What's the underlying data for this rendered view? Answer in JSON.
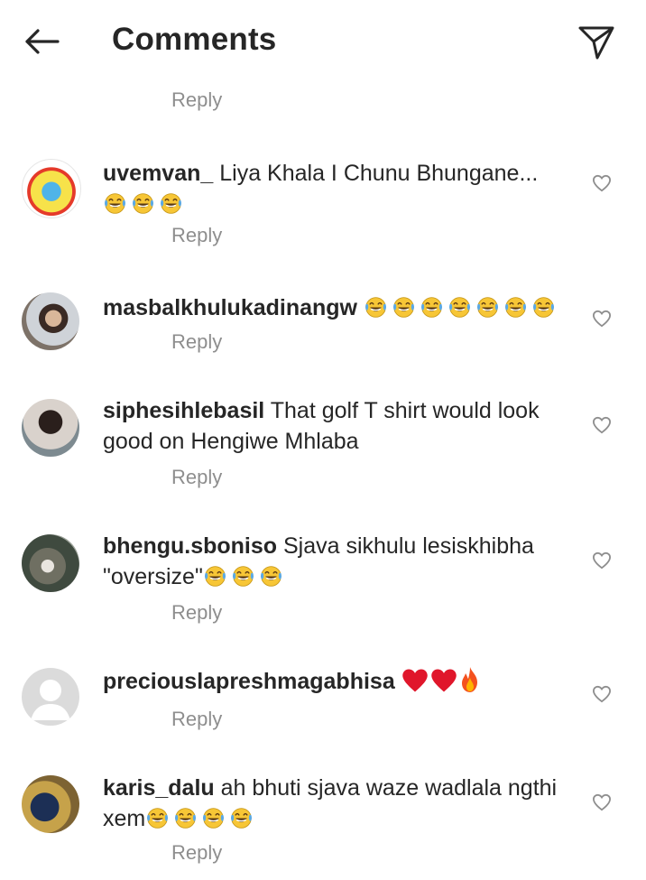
{
  "header": {
    "title": "Comments",
    "back_icon": "arrow-left-icon",
    "send_icon": "paper-plane-icon"
  },
  "top_reply_label": "Reply",
  "comments": [
    {
      "username": "uvemvan_",
      "text": " Liya Khala I Chunu Bhungane...",
      "emojis": 3,
      "reply_label": "Reply"
    },
    {
      "username": "masbalkhulukadinangw",
      "text": " ",
      "emojis": 7,
      "reply_label": "Reply"
    },
    {
      "username": "siphesihlebasil",
      "text": " That golf T shirt would look good on Hengiwe Mhlaba",
      "emojis": 0,
      "reply_label": "Reply"
    },
    {
      "username": "bhengu.sboniso",
      "text": " Sjava sikhulu lesiskhibha \"oversize\"",
      "emojis": 3,
      "reply_label": "Reply"
    },
    {
      "username": "preciouslapreshmagabhisa",
      "text": " ",
      "emojis": 0,
      "hearts": 2,
      "fire": 1,
      "reply_label": "Reply"
    },
    {
      "username": "karis_dalu",
      "text": " ah bhuti sjava waze wadlala ngthi xem",
      "emojis": 4,
      "reply_label": "Reply"
    }
  ],
  "colors": {
    "text": "#262626",
    "muted": "#8e8e8e",
    "emoji_face": "#f7c636",
    "tear": "#5aa9e6",
    "heart_red": "#e0162b"
  }
}
